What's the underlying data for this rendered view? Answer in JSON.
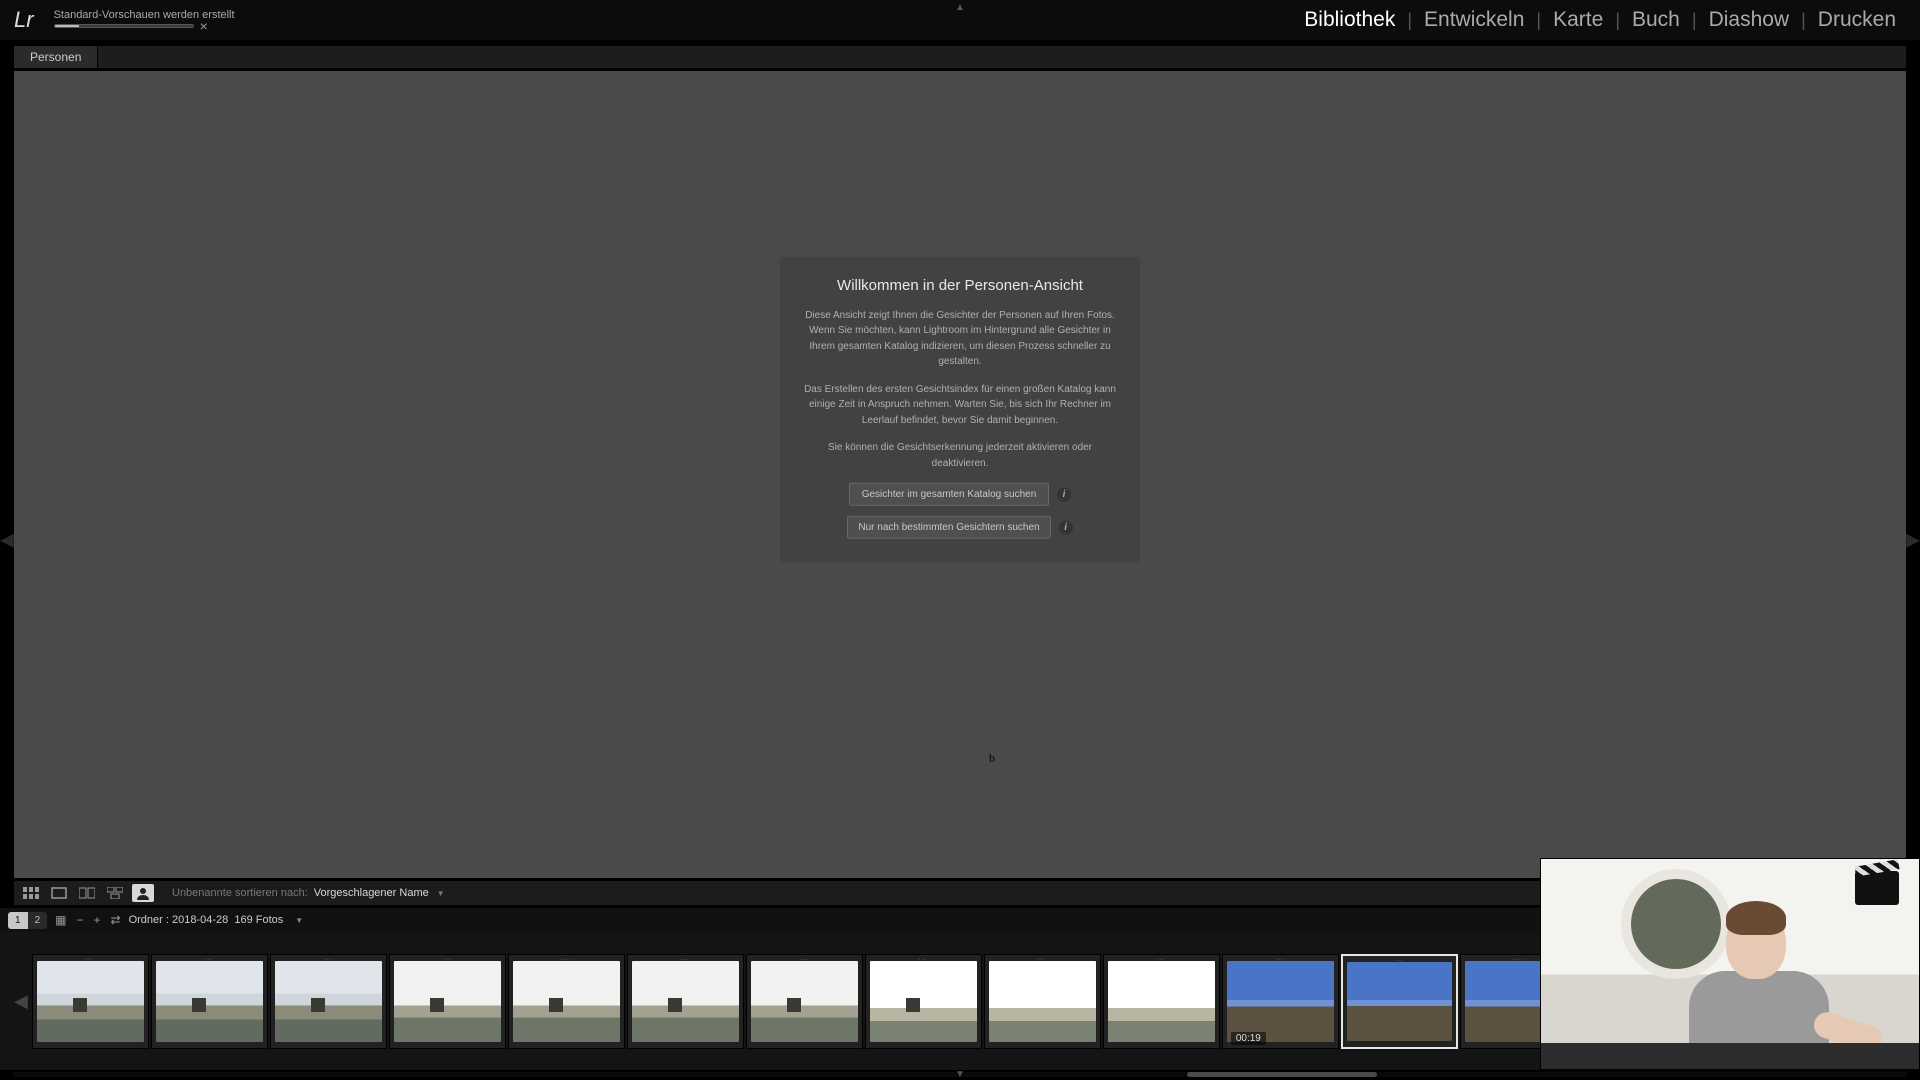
{
  "app": {
    "logo_text": "Lr"
  },
  "task": {
    "label": "Standard-Vorschauen werden erstellt",
    "progress_pct": 18,
    "close_glyph": "×"
  },
  "modules": {
    "items": [
      "Bibliothek",
      "Entwickeln",
      "Karte",
      "Buch",
      "Diashow",
      "Drucken"
    ],
    "active_index": 0,
    "separator": "|"
  },
  "view_tabs": {
    "active": "Personen"
  },
  "dialog": {
    "title": "Willkommen in der Personen-Ansicht",
    "p1": "Diese Ansicht zeigt Ihnen die Gesichter der Personen auf Ihren Fotos. Wenn Sie möchten, kann Lightroom im Hintergrund alle Gesichter in Ihrem gesamten Katalog indizieren, um diesen Prozess schneller zu gestalten.",
    "p2": "Das Erstellen des ersten Gesichtsindex für einen großen Katalog kann einige Zeit in Anspruch nehmen. Warten Sie, bis sich Ihr Rechner im Leerlauf befindet, bevor Sie damit beginnen.",
    "p3": "Sie können die Gesichtserkennung jederzeit aktivieren oder deaktivieren.",
    "btn1": "Gesichter im gesamten Katalog suchen",
    "btn2": "Nur nach bestimmten Gesichtern suchen",
    "info_glyph": "i"
  },
  "toolbar": {
    "sort_label": "Unbenannte sortieren nach:",
    "sort_value": "Vorgeschlagener Name"
  },
  "secondary_bar": {
    "seg_left": "1",
    "seg_right": "2",
    "grid_glyph": "▦",
    "minus": "−",
    "plus": "+",
    "sync": "⇄",
    "path": "Ordner : 2018-04-28",
    "count": "169 Fotos"
  },
  "filmstrip": {
    "video_badge": "00:19",
    "thumbs": [
      {
        "style": "sky-mid",
        "castle": true
      },
      {
        "style": "sky-mid",
        "castle": true
      },
      {
        "style": "sky-mid",
        "castle": true
      },
      {
        "style": "sky-light",
        "castle": true
      },
      {
        "style": "sky-light",
        "castle": true
      },
      {
        "style": "sky-light",
        "castle": true
      },
      {
        "style": "sky-light",
        "castle": true
      },
      {
        "style": "sky-bright",
        "castle": true
      },
      {
        "style": "sky-bright"
      },
      {
        "style": "sky-bright"
      },
      {
        "style": "sky-blue",
        "video": true
      },
      {
        "style": "sky-blue",
        "selected": true
      },
      {
        "style": "sky-blue"
      },
      {
        "style": "sky-dusk"
      },
      {
        "style": "sky-dusk"
      },
      {
        "style": "sky-dusk"
      },
      {
        "style": "sky-dusk"
      }
    ]
  },
  "cursor_glyph": "b"
}
